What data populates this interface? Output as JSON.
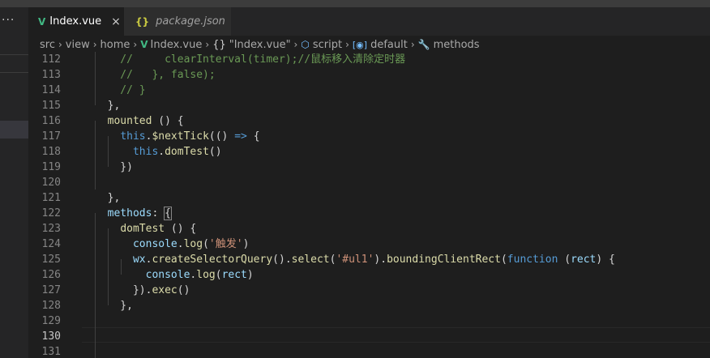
{
  "sidebar": {
    "more": "···"
  },
  "tabs": [
    {
      "icon": "V",
      "label": "Index.vue",
      "close": "×"
    },
    {
      "icon": "{}",
      "label": "package.json"
    }
  ],
  "breadcrumb": {
    "src": "src",
    "view": "view",
    "home": "home",
    "file": "Index.vue",
    "braces": "{}",
    "component": "\"Index.vue\"",
    "script": "script",
    "default": "default",
    "methods": "methods"
  },
  "editor": {
    "active_line": 130,
    "lines": [
      {
        "n": "112",
        "tokens": [
          {
            "t": "    //     clearInterval(timer);//鼠标移入清除定时器",
            "c": "com"
          }
        ]
      },
      {
        "n": "113",
        "tokens": [
          {
            "t": "    //   }, false);",
            "c": "com"
          }
        ]
      },
      {
        "n": "114",
        "tokens": [
          {
            "t": "    // }",
            "c": "com"
          }
        ]
      },
      {
        "n": "115",
        "tokens": [
          {
            "t": "  },",
            "c": "p"
          }
        ]
      },
      {
        "n": "116",
        "tokens": [
          {
            "t": "  ",
            "c": "p"
          },
          {
            "t": "mounted",
            "c": "fn"
          },
          {
            "t": " () {",
            "c": "p"
          }
        ]
      },
      {
        "n": "117",
        "tokens": [
          {
            "t": "    ",
            "c": "p"
          },
          {
            "t": "this",
            "c": "kw"
          },
          {
            "t": ".",
            "c": "p"
          },
          {
            "t": "$nextTick",
            "c": "fn"
          },
          {
            "t": "(() ",
            "c": "p"
          },
          {
            "t": "=>",
            "c": "kw"
          },
          {
            "t": " {",
            "c": "p"
          }
        ]
      },
      {
        "n": "118",
        "tokens": [
          {
            "t": "      ",
            "c": "p"
          },
          {
            "t": "this",
            "c": "kw"
          },
          {
            "t": ".",
            "c": "p"
          },
          {
            "t": "domTest",
            "c": "fn"
          },
          {
            "t": "()",
            "c": "p"
          }
        ]
      },
      {
        "n": "119",
        "tokens": [
          {
            "t": "    })",
            "c": "p"
          }
        ]
      },
      {
        "n": "120",
        "tokens": []
      },
      {
        "n": "121",
        "tokens": [
          {
            "t": "  },",
            "c": "p"
          }
        ]
      },
      {
        "n": "122",
        "tokens": [
          {
            "t": "  ",
            "c": "p"
          },
          {
            "t": "methods",
            "c": "var"
          },
          {
            "t": ": ",
            "c": "p"
          },
          {
            "t": "{",
            "c": "p",
            "hl": true
          }
        ]
      },
      {
        "n": "123",
        "tokens": [
          {
            "t": "    ",
            "c": "p"
          },
          {
            "t": "domTest",
            "c": "fn"
          },
          {
            "t": " () {",
            "c": "p"
          }
        ]
      },
      {
        "n": "124",
        "tokens": [
          {
            "t": "      ",
            "c": "p"
          },
          {
            "t": "console",
            "c": "var"
          },
          {
            "t": ".",
            "c": "p"
          },
          {
            "t": "log",
            "c": "fn"
          },
          {
            "t": "(",
            "c": "p"
          },
          {
            "t": "'触发'",
            "c": "str"
          },
          {
            "t": ")",
            "c": "p"
          }
        ]
      },
      {
        "n": "125",
        "tokens": [
          {
            "t": "      ",
            "c": "p"
          },
          {
            "t": "wx",
            "c": "var"
          },
          {
            "t": ".",
            "c": "p"
          },
          {
            "t": "createSelectorQuery",
            "c": "fn"
          },
          {
            "t": "().",
            "c": "p"
          },
          {
            "t": "select",
            "c": "fn"
          },
          {
            "t": "(",
            "c": "p"
          },
          {
            "t": "'#ul1'",
            "c": "str"
          },
          {
            "t": ").",
            "c": "p"
          },
          {
            "t": "boundingClientRect",
            "c": "fn"
          },
          {
            "t": "(",
            "c": "p"
          },
          {
            "t": "function",
            "c": "kw"
          },
          {
            "t": " (",
            "c": "p"
          },
          {
            "t": "rect",
            "c": "var"
          },
          {
            "t": ") {",
            "c": "p"
          }
        ]
      },
      {
        "n": "126",
        "tokens": [
          {
            "t": "        ",
            "c": "p"
          },
          {
            "t": "console",
            "c": "var"
          },
          {
            "t": ".",
            "c": "p"
          },
          {
            "t": "log",
            "c": "fn"
          },
          {
            "t": "(",
            "c": "p"
          },
          {
            "t": "rect",
            "c": "var"
          },
          {
            "t": ")",
            "c": "p"
          }
        ]
      },
      {
        "n": "127",
        "tokens": [
          {
            "t": "      }).",
            "c": "p"
          },
          {
            "t": "exec",
            "c": "fn"
          },
          {
            "t": "()",
            "c": "p"
          }
        ]
      },
      {
        "n": "128",
        "tokens": [
          {
            "t": "    },",
            "c": "p"
          }
        ]
      },
      {
        "n": "129",
        "tokens": []
      },
      {
        "n": "130",
        "tokens": []
      },
      {
        "n": "131",
        "tokens": []
      }
    ]
  }
}
